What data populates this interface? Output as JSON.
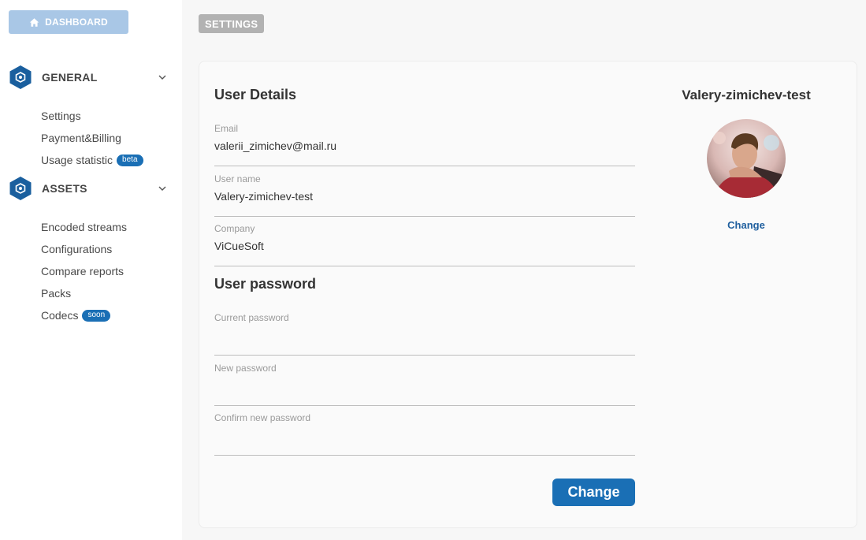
{
  "sidebar": {
    "dashboard_label": "DASHBOARD",
    "sections": [
      {
        "label": "GENERAL",
        "items": [
          {
            "label": "Settings"
          },
          {
            "label": "Payment&Billing"
          },
          {
            "label": "Usage statistic",
            "badge": "beta"
          }
        ]
      },
      {
        "label": "ASSETS",
        "items": [
          {
            "label": "Encoded streams"
          },
          {
            "label": "Configurations"
          },
          {
            "label": "Compare reports"
          },
          {
            "label": "Packs"
          },
          {
            "label": "Codecs",
            "badge": "soon"
          }
        ]
      }
    ]
  },
  "page": {
    "title": "SETTINGS"
  },
  "user_details": {
    "title": "User Details",
    "email": {
      "label": "Email",
      "value": "valerii_zimichev@mail.ru"
    },
    "username": {
      "label": "User name",
      "value": "Valery-zimichev-test"
    },
    "company": {
      "label": "Company",
      "value": "ViCueSoft"
    }
  },
  "password": {
    "title": "User password",
    "current_label": "Current password",
    "new_label": "New password",
    "confirm_label": "Confirm new password",
    "submit_label": "Change"
  },
  "profile": {
    "name": "Valery-zimichev-test",
    "change_label": "Change"
  },
  "colors": {
    "accent": "#1a6fb5",
    "dashboard_button": "#a9c7e6",
    "hex_icon": "#1a5f9e"
  }
}
